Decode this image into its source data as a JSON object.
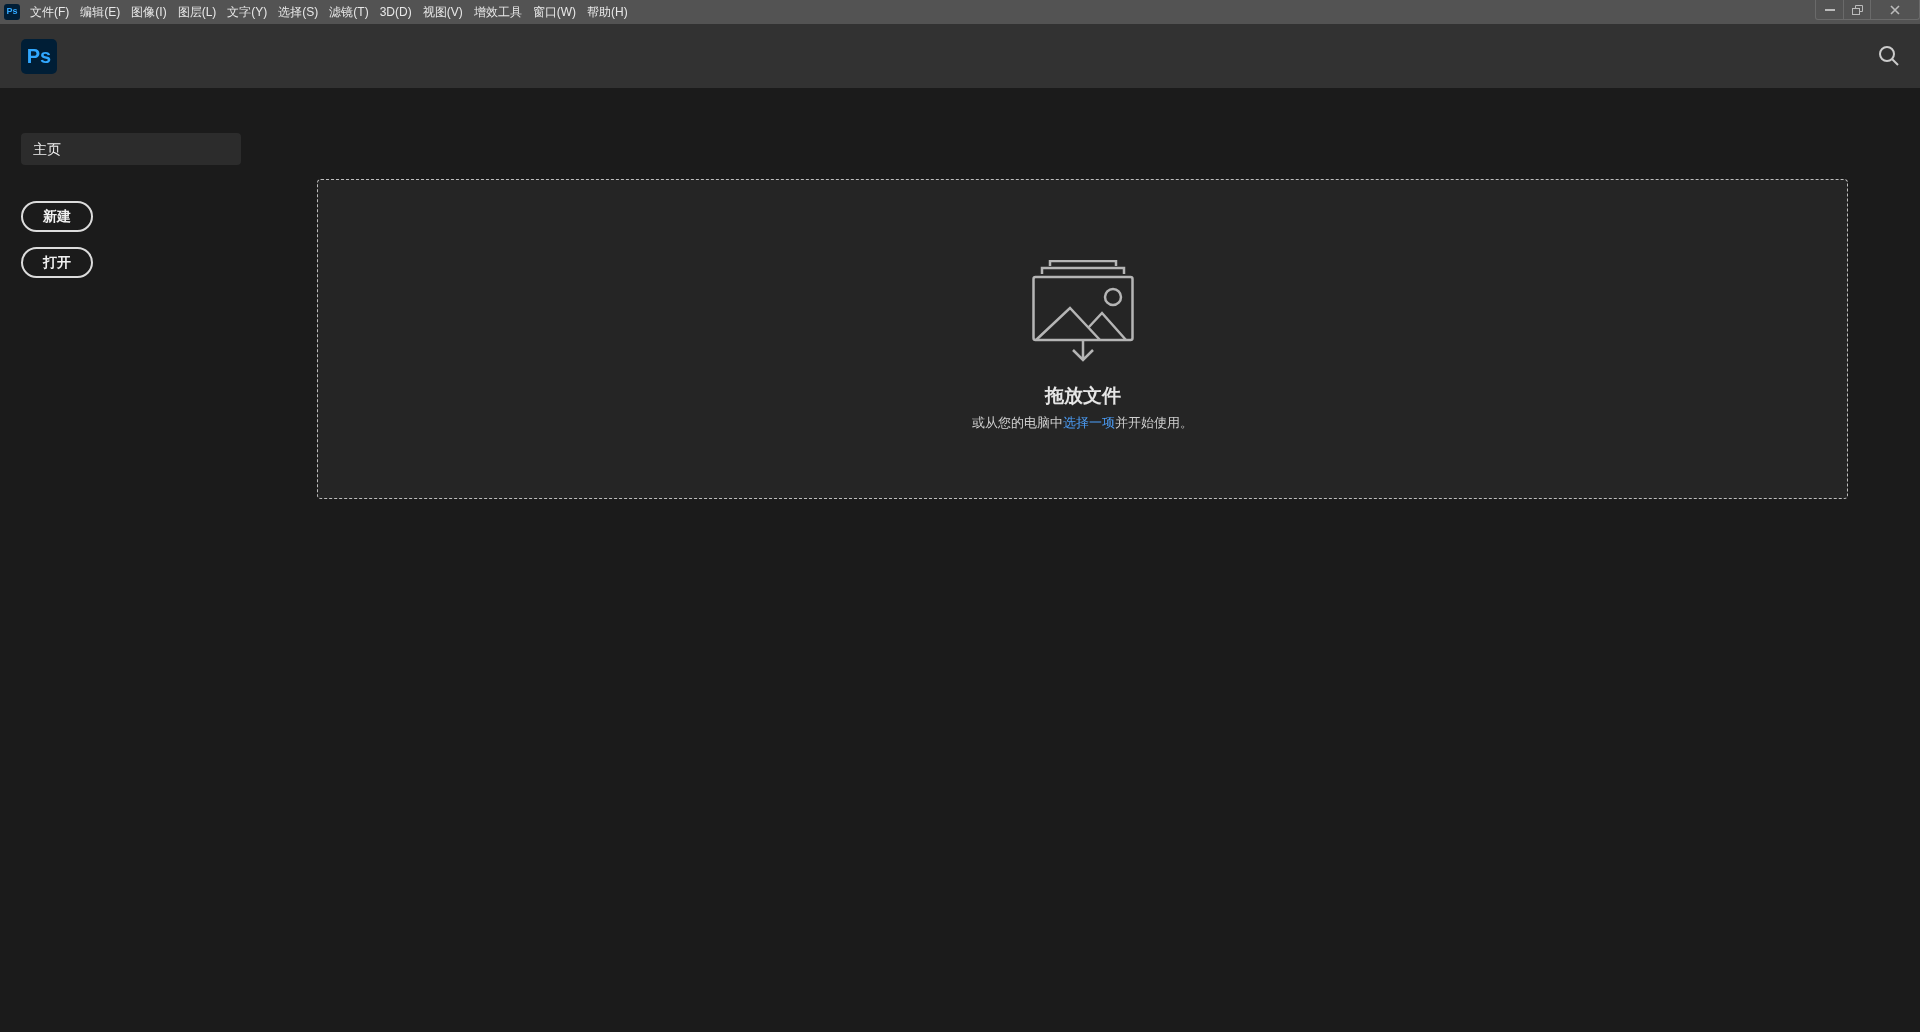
{
  "app_icon": {
    "text": "Ps"
  },
  "menu_bar": [
    "文件(F)",
    "编辑(E)",
    "图像(I)",
    "图层(L)",
    "文字(Y)",
    "选择(S)",
    "滤镜(T)",
    "3D(D)",
    "视图(V)",
    "增效工具",
    "窗口(W)",
    "帮助(H)"
  ],
  "header": {
    "logo": "Ps"
  },
  "sidebar": {
    "items": [
      {
        "label": "主页",
        "selected": true
      }
    ],
    "buttons": [
      "新建",
      "打开"
    ]
  },
  "drop_zone": {
    "title": "拖放文件",
    "text_before": "或从您的电脑中",
    "link": "选择一项",
    "text_after": "并开始使用。"
  }
}
